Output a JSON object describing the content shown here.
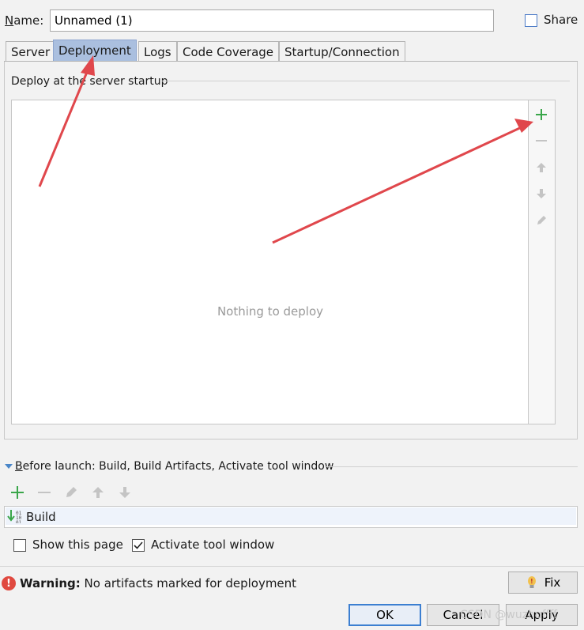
{
  "name_row": {
    "label": "Name:",
    "label_mnemonic": "N",
    "label_rest": "ame:",
    "value": "Unnamed (1)"
  },
  "share": {
    "label": "Share",
    "checked": false
  },
  "tabs": [
    {
      "label": "Server",
      "active": false
    },
    {
      "label": "Deployment",
      "active": true
    },
    {
      "label": "Logs",
      "active": false
    },
    {
      "label": "Code Coverage",
      "active": false
    },
    {
      "label": "Startup/Connection",
      "active": false
    }
  ],
  "deployment": {
    "group_title": "Deploy at the server startup",
    "empty_text": "Nothing to deploy",
    "toolbar_icons": [
      "add-icon",
      "remove-icon",
      "move-up-icon",
      "move-down-icon",
      "edit-icon"
    ]
  },
  "before_launch": {
    "title": "Before launch: Build, Build Artifacts, Activate tool window",
    "title_mnemonic": "B",
    "title_rest": "efore launch: Build, Build Artifacts, Activate tool window",
    "toolbar_icons": [
      "add-icon",
      "remove-icon",
      "edit-icon",
      "move-up-icon",
      "move-down-icon"
    ],
    "tasks": [
      {
        "label": "Build",
        "icon": "build-icon"
      }
    ]
  },
  "options": {
    "show_page": {
      "label": "Show this page",
      "checked": false
    },
    "activate_window": {
      "label": "Activate tool window",
      "checked": true
    }
  },
  "warning": {
    "bold": "Warning:",
    "text": " No artifacts marked for deployment"
  },
  "buttons": {
    "fix": "Fix",
    "ok": "OK",
    "cancel": "Cancel",
    "apply": "Apply"
  },
  "watermark": "CSDN @wuzhuffff",
  "colors": {
    "active_tab": "#aabfdf",
    "add_green": "#3aa64a",
    "annotation_arrow": "#e0474c",
    "warning_red": "#e0493f"
  }
}
